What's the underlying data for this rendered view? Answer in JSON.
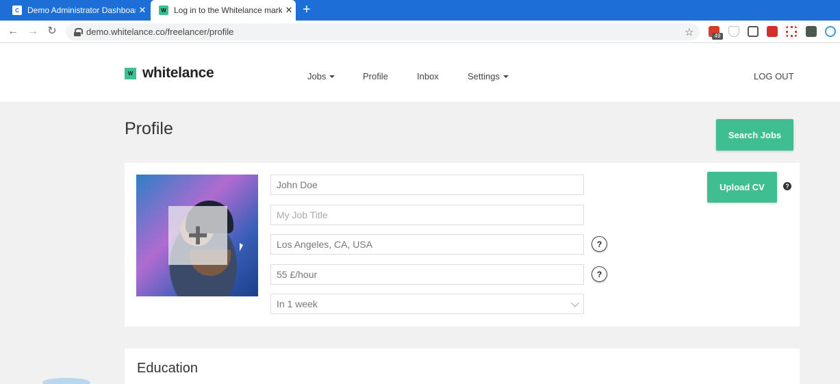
{
  "browser": {
    "tabs": [
      {
        "title": "Demo Administrator Dashboard",
        "favicon": "C",
        "close": "✕"
      },
      {
        "title": "Log in to the Whitelance marketp",
        "favicon": "W",
        "close": "✕"
      }
    ],
    "new_tab": "+",
    "url": "demo.whitelance.co/freelancer/profile",
    "ext_badge": "49"
  },
  "site": {
    "logo_mark": "W",
    "logo_text": "whitelance",
    "nav": {
      "jobs": "Jobs",
      "profile": "Profile",
      "inbox": "Inbox",
      "settings": "Settings"
    },
    "logout": "LOG OUT"
  },
  "page": {
    "title": "Profile",
    "search_jobs": "Search Jobs",
    "upload_cv": "Upload CV",
    "fields": {
      "name": "John Doe",
      "job_title_placeholder": "My Job Title",
      "location": "Los Angeles, CA, USA",
      "rate": "55 £/hour",
      "availability": "In 1 week"
    },
    "help_glyph": "?",
    "upload_plus": "+",
    "education_title": "Education"
  },
  "colors": {
    "brand_green": "#3fbf91",
    "chrome_blue": "#1b6fd6"
  }
}
